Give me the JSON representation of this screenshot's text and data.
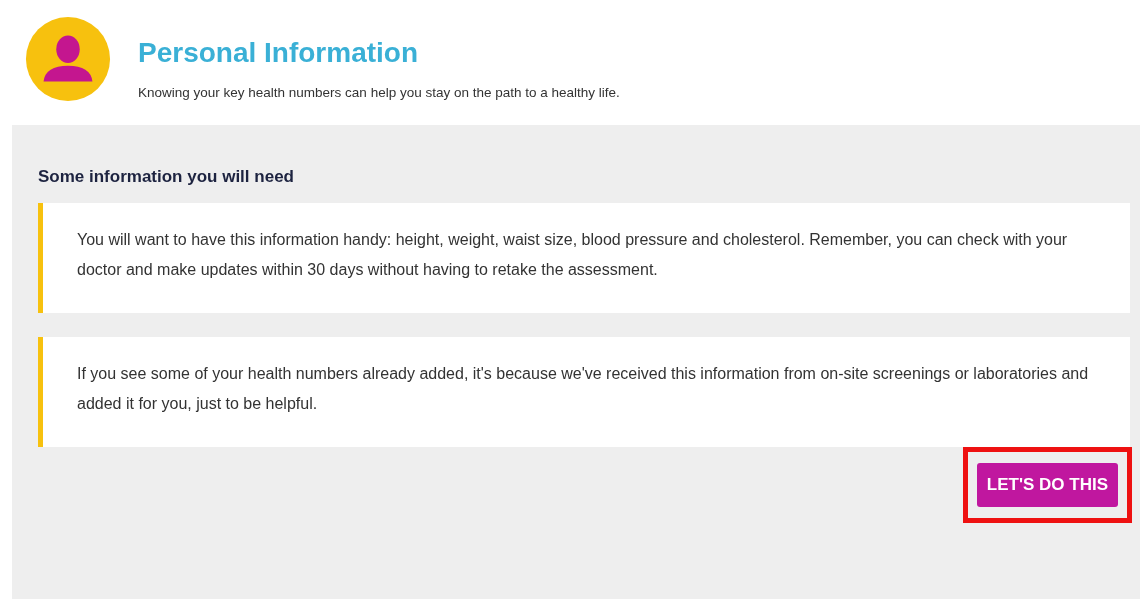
{
  "header": {
    "title": "Personal Information",
    "subtitle": "Knowing your key health numbers can help you stay on the path to a healthy life."
  },
  "section": {
    "heading": "Some information you will need",
    "notes": [
      {
        "text": "You will want to have this information handy: height, weight, waist size, blood pressure and cholesterol. Remember, you can check with your doctor and make updates within 30 days without having to retake the assessment."
      },
      {
        "text": "If you see some of your health numbers already added, it's because we've received this information from on-site screenings or laboratories and added it for you, just to be helpful."
      }
    ]
  },
  "button": {
    "label": "LET'S DO THIS",
    "highlighted": true
  }
}
